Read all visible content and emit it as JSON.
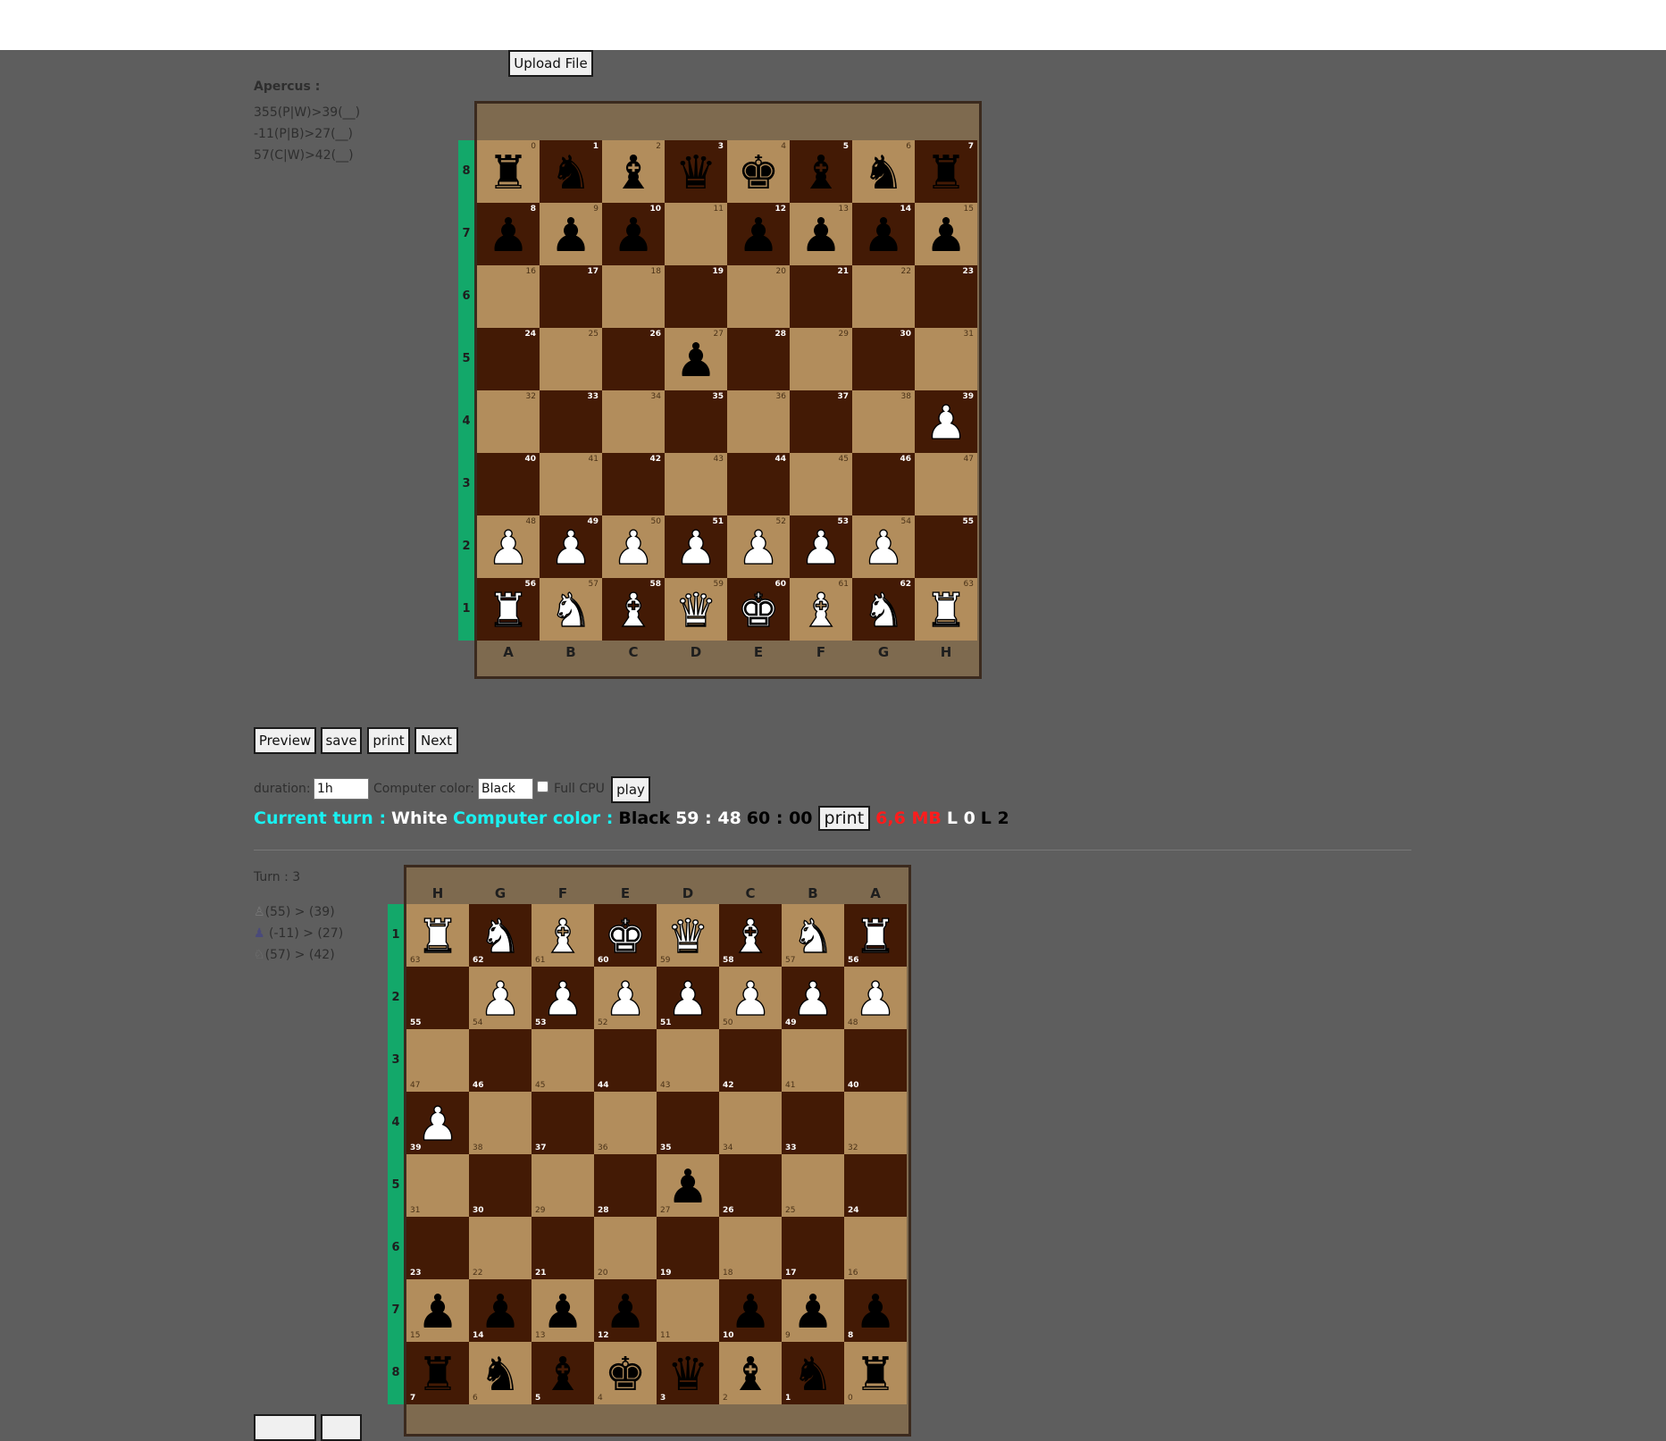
{
  "toolbar": {
    "upload_label": "Upload File"
  },
  "apercus": {
    "title": "Apercus :",
    "lines": [
      "355(P|W)>39(__)",
      "-11(P|B)>27(__)",
      "57(C|W)>42(__)"
    ]
  },
  "board": {
    "files": [
      "A",
      "B",
      "C",
      "D",
      "E",
      "F",
      "G",
      "H"
    ],
    "ranks": [
      "8",
      "7",
      "6",
      "5",
      "4",
      "3",
      "2",
      "1"
    ],
    "flipped_files": [
      "H",
      "G",
      "F",
      "E",
      "D",
      "C",
      "B",
      "A"
    ],
    "flipped_ranks": [
      "1",
      "2",
      "3",
      "4",
      "5",
      "6",
      "7",
      "8"
    ],
    "colors": {
      "light": "#b28d5c",
      "dark": "#431a05",
      "frame": "#7e6a4f",
      "rank_bar": "#13a86a"
    },
    "pieces": [
      "r",
      "n",
      "b",
      "q",
      "k",
      "b",
      "n",
      "r",
      "p",
      "p",
      "p",
      "",
      "p",
      "p",
      "p",
      "p",
      "",
      "",
      "",
      "",
      "",
      "",
      "",
      "",
      "",
      "",
      "",
      "p",
      "",
      "",
      "",
      "",
      "",
      "",
      "",
      "",
      "",
      "",
      "",
      "P",
      "",
      "",
      "",
      "",
      "",
      "",
      "",
      "",
      "P",
      "P",
      "P",
      "P",
      "P",
      "P",
      "P",
      "",
      "R",
      "N",
      "B",
      "Q",
      "K",
      "B",
      "N",
      "R"
    ]
  },
  "controls": {
    "preview": "Preview",
    "save": "save",
    "print": "print",
    "next": "Next",
    "duration_label": "duration:",
    "duration_value": "1h",
    "computer_color_label": "Computer color:",
    "computer_color_value": "Black",
    "full_cpu_label": "Full CPU",
    "play": "play"
  },
  "status": {
    "current_turn_label": "Current turn :",
    "current_turn_value": "White",
    "computer_color_label": "Computer color :",
    "computer_color_value": "Black",
    "timer_white": "59 : 48",
    "timer_black": "60 : 00",
    "print_label": "print",
    "memory": "6,6 MB",
    "l_white": "L 0",
    "l_black": "L 2"
  },
  "history": {
    "turn": "Turn : 3",
    "moves": [
      {
        "icon": "♙",
        "text": "(55) > (39)"
      },
      {
        "icon": "♟",
        "text": " (-11) > (27)"
      },
      {
        "icon": "♘",
        "text": "(57) > (42)"
      }
    ]
  }
}
